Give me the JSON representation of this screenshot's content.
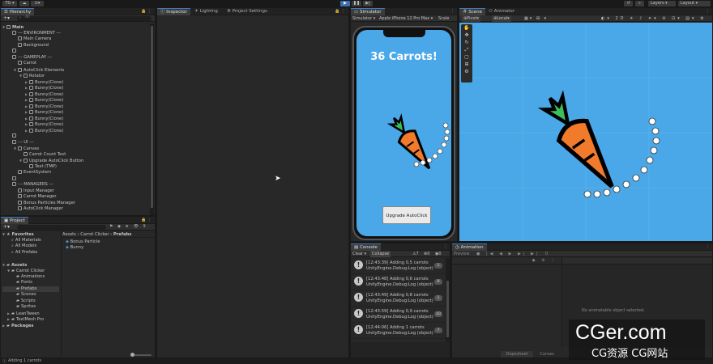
{
  "toolbar": {
    "account": "TG",
    "layers": "Layers",
    "layout": "Layout"
  },
  "hierarchy": {
    "tab": "Hierarchy",
    "search_placeholder": "All",
    "rows": [
      {
        "label": "Main",
        "depth": 0,
        "arrow": "▼",
        "bold": true
      },
      {
        "label": "--- ENVIRONMENT ---",
        "depth": 1,
        "arrow": ""
      },
      {
        "label": "Main Camera",
        "depth": 2,
        "arrow": ""
      },
      {
        "label": "Background",
        "depth": 2,
        "arrow": ""
      },
      {
        "label": "",
        "depth": 1,
        "arrow": ""
      },
      {
        "label": "--- GAMEPLAY ---",
        "depth": 1,
        "arrow": ""
      },
      {
        "label": "Carrot",
        "depth": 2,
        "arrow": ""
      },
      {
        "label": "AutoClick Elements",
        "depth": 2,
        "arrow": "▼"
      },
      {
        "label": "Rotator",
        "depth": 3,
        "arrow": "▼"
      },
      {
        "label": "Bunny(Clone)",
        "depth": 4,
        "arrow": "▶"
      },
      {
        "label": "Bunny(Clone)",
        "depth": 4,
        "arrow": "▶"
      },
      {
        "label": "Bunny(Clone)",
        "depth": 4,
        "arrow": "▶"
      },
      {
        "label": "Bunny(Clone)",
        "depth": 4,
        "arrow": "▶"
      },
      {
        "label": "Bunny(Clone)",
        "depth": 4,
        "arrow": "▶"
      },
      {
        "label": "Bunny(Clone)",
        "depth": 4,
        "arrow": "▶"
      },
      {
        "label": "Bunny(Clone)",
        "depth": 4,
        "arrow": "▶"
      },
      {
        "label": "Bunny(Clone)",
        "depth": 4,
        "arrow": "▶"
      },
      {
        "label": "Bunny(Clone)",
        "depth": 4,
        "arrow": "▶"
      },
      {
        "label": "",
        "depth": 1,
        "arrow": ""
      },
      {
        "label": "--- UI ---",
        "depth": 1,
        "arrow": ""
      },
      {
        "label": "Canvas",
        "depth": 2,
        "arrow": "▼"
      },
      {
        "label": "Carrot Count Text",
        "depth": 3,
        "arrow": ""
      },
      {
        "label": "Upgrade AutoClick Button",
        "depth": 3,
        "arrow": "▼"
      },
      {
        "label": "Text (TMP)",
        "depth": 4,
        "arrow": ""
      },
      {
        "label": "EventSystem",
        "depth": 2,
        "arrow": ""
      },
      {
        "label": "",
        "depth": 1,
        "arrow": ""
      },
      {
        "label": "--- MANAGERS ---",
        "depth": 1,
        "arrow": ""
      },
      {
        "label": "Input Manager",
        "depth": 2,
        "arrow": ""
      },
      {
        "label": "Carrot Manager",
        "depth": 2,
        "arrow": ""
      },
      {
        "label": "Bonus Particles Manager",
        "depth": 2,
        "arrow": ""
      },
      {
        "label": "AutoClick Manager",
        "depth": 2,
        "arrow": ""
      }
    ]
  },
  "inspector": {
    "tabs": [
      "Inspector",
      "Lighting",
      "Project Settings"
    ]
  },
  "project": {
    "tab": "Project",
    "breadcrumb": [
      "Assets",
      "Carrot Clicker",
      "Prefabs"
    ],
    "tree": [
      {
        "label": "Favorites",
        "depth": 0,
        "arrow": "▼",
        "bold": true
      },
      {
        "label": "All Materials",
        "depth": 1,
        "arrow": ""
      },
      {
        "label": "All Models",
        "depth": 1,
        "arrow": ""
      },
      {
        "label": "All Prefabs",
        "depth": 1,
        "arrow": ""
      },
      {
        "label": "",
        "depth": 0,
        "arrow": ""
      },
      {
        "label": "Assets",
        "depth": 0,
        "arrow": "▼",
        "bold": true
      },
      {
        "label": "Carrot Clicker",
        "depth": 1,
        "arrow": "▼"
      },
      {
        "label": "Animations",
        "depth": 2,
        "arrow": ""
      },
      {
        "label": "Fonts",
        "depth": 2,
        "arrow": ""
      },
      {
        "label": "Prefabs",
        "depth": 2,
        "arrow": "",
        "selected": true
      },
      {
        "label": "Scenes",
        "depth": 2,
        "arrow": ""
      },
      {
        "label": "Scripts",
        "depth": 2,
        "arrow": ""
      },
      {
        "label": "Sprites",
        "depth": 2,
        "arrow": ""
      },
      {
        "label": "LeanTween",
        "depth": 1,
        "arrow": "▶"
      },
      {
        "label": "TextMesh Pro",
        "depth": 1,
        "arrow": "▶"
      },
      {
        "label": "Packages",
        "depth": 0,
        "arrow": "▶",
        "bold": true
      }
    ],
    "files": [
      "Bonus Particle",
      "Bunny"
    ]
  },
  "simulator": {
    "tab": "Simulator",
    "mode": "Simulator",
    "device": "Apple iPhone 12 Pro Max",
    "scale": "Scale",
    "score": "36 Carrots!",
    "button": "Upgrade AutoClick"
  },
  "scene": {
    "tabs": [
      "Scene",
      "Animator"
    ],
    "pivot": "Pivot",
    "local": "Local"
  },
  "console": {
    "tab": "Console",
    "clear": "Clear",
    "collapse": "Collapse",
    "warn_count": "7",
    "err_count": "0",
    "logs": [
      {
        "time": "[12:43:39] Adding 0,5 carrots",
        "source": "UnityEngine.Debug:Log (object)",
        "count": "1"
      },
      {
        "time": "[12:43:48] Adding 0,6 carrots",
        "source": "UnityEngine.Debug:Log (object)",
        "count": "9"
      },
      {
        "time": "[12:43:49] Adding 0,8 carrots",
        "source": "UnityEngine.Debug:Log (object)",
        "count": "1"
      },
      {
        "time": "[12:43:59] Adding 0,9 carrots",
        "source": "UnityEngine.Debug:Log (object)",
        "count": "10"
      },
      {
        "time": "[12:44:06] Adding 1 carrots",
        "source": "UnityEngine.Debug:Log (object)",
        "count": "7"
      }
    ]
  },
  "animation": {
    "tab": "Animation",
    "preview": "Preview",
    "empty": "No animatable object selected.",
    "dopesheet": "Dopesheet",
    "curves": "Curves"
  },
  "status": {
    "text": "Adding 1 carrots"
  },
  "watermark": {
    "main": "CGer.com",
    "sub": "CG资源 CG网站"
  },
  "colors": {
    "sky": "#4aa8e8",
    "carrot": "#f27a2b",
    "leaf": "#3dbd5c",
    "accent": "#3a79c0"
  }
}
